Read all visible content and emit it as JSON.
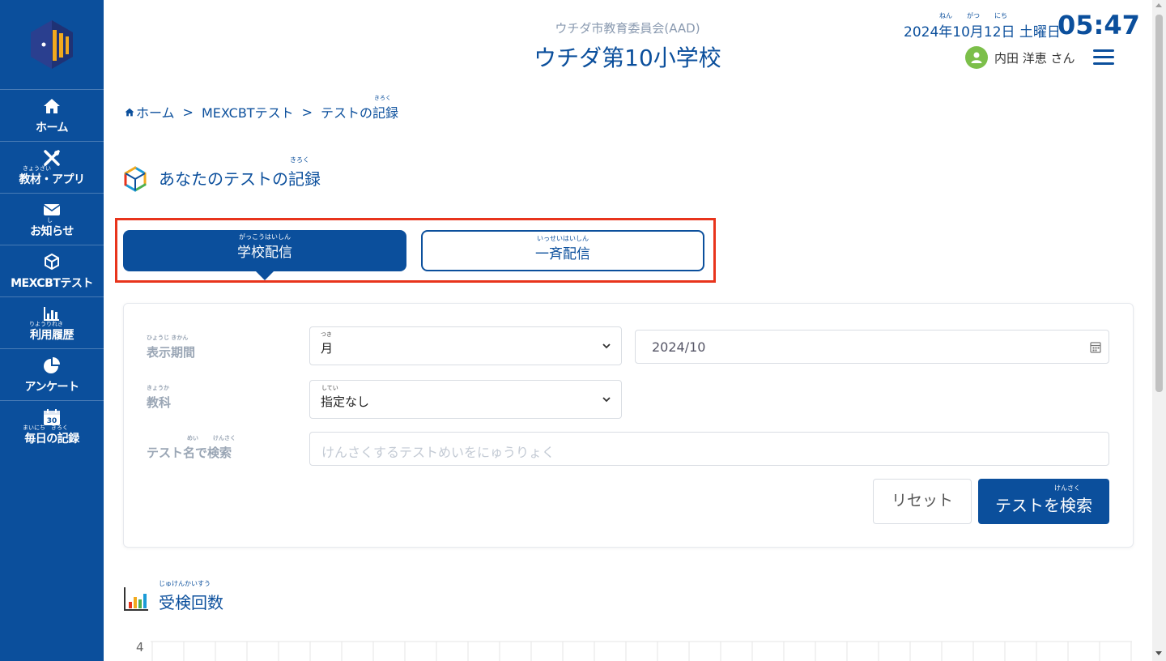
{
  "sidebar": {
    "logo_icon": "school-logo-icon",
    "items": [
      {
        "label": "ホーム",
        "ruby": "",
        "icon": "home-icon"
      },
      {
        "label": "教材・アプリ",
        "ruby": "きょうざい",
        "icon": "tools-icon"
      },
      {
        "label": "お知らせ",
        "ruby": "し",
        "icon": "mail-icon"
      },
      {
        "label": "MEXCBTテスト",
        "ruby": "",
        "icon": "cube-icon"
      },
      {
        "label": "利用履歴",
        "ruby": "りようりれき",
        "icon": "bar-chart-icon"
      },
      {
        "label": "アンケート",
        "ruby": "",
        "icon": "pie-chart-icon"
      },
      {
        "label": "毎日の記録",
        "ruby": "まいにち　きろく",
        "icon": "calendar-icon"
      }
    ]
  },
  "header": {
    "subtitle": "ウチダ市教育委員会(AAD)",
    "title": "ウチダ第10小学校",
    "date": "2024年10月12日 土曜日",
    "date_ruby": {
      "year": "ねん",
      "month": "がつ",
      "day": "にち"
    },
    "time": "05:47",
    "user_name": "内田 洋恵 さん"
  },
  "breadcrumb": {
    "home": "ホーム",
    "mexcbt": "MEXCBTテスト",
    "current": "テストの記録",
    "current_ruby": "きろく"
  },
  "section": {
    "title": "あなたのテストの記録",
    "title_ruby": "きろく"
  },
  "tabs": [
    {
      "label": "学校配信",
      "ruby": "がっこうはいしん",
      "active": true
    },
    {
      "label": "一斉配信",
      "ruby": "いっせいはいしん",
      "active": false
    }
  ],
  "filters": {
    "period_label": "表示期間",
    "period_ruby": "ひょうじ きかん",
    "period_value": "月",
    "period_value_ruby": "つき",
    "month_value": "2024/10",
    "subject_label": "教科",
    "subject_ruby": "きょうか",
    "subject_value": "指定なし",
    "subject_value_ruby": "してい",
    "search_label": "テスト名で検索",
    "search_ruby_mei": "めい",
    "search_ruby_kensaku": "けんさく",
    "search_placeholder": "けんさくするテストめいをにゅうりょく",
    "reset_label": "リセット",
    "search_button_label": "テストを検索",
    "search_button_ruby": "けんさく"
  },
  "chart_section": {
    "title": "受検回数",
    "title_ruby": "じゅけんかいすう",
    "y_tick_top": "4"
  },
  "colors": {
    "primary": "#0b4f9c",
    "highlight": "#e8341c",
    "avatar": "#7cbf4a"
  }
}
